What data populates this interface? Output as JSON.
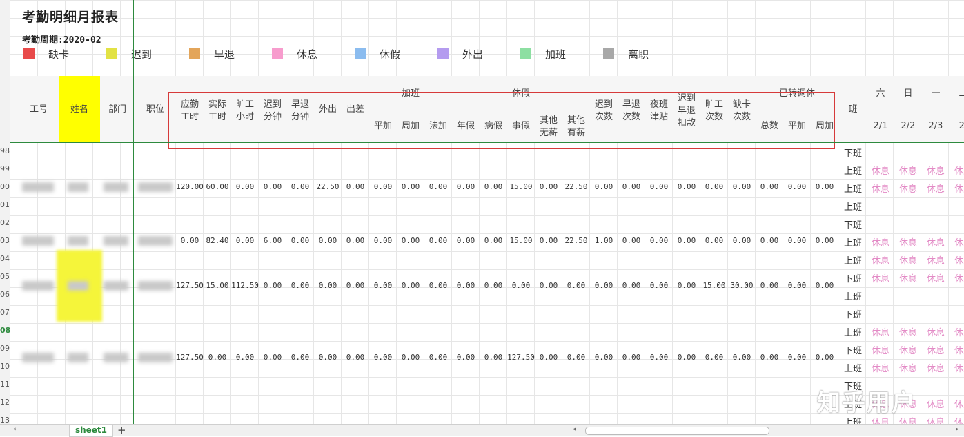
{
  "title": "考勤明细月报表",
  "period": "考勤周期:2020-02",
  "legend": [
    {
      "label": "缺卡",
      "color": "#e84a4a"
    },
    {
      "label": "迟到",
      "color": "#e2e244"
    },
    {
      "label": "早退",
      "color": "#e3a55a"
    },
    {
      "label": "休息",
      "color": "#f79ccd"
    },
    {
      "label": "休假",
      "color": "#8bbcef"
    },
    {
      "label": "外出",
      "color": "#b49bef"
    },
    {
      "label": "加班",
      "color": "#8ddfa2"
    },
    {
      "label": "离职",
      "color": "#a8a8a8"
    }
  ],
  "row_numbers": [
    "98",
    "99",
    "00",
    "01",
    "02",
    "03",
    "04",
    "05",
    "06",
    "07",
    "08",
    "09",
    "10",
    "11",
    "12",
    "13"
  ],
  "headers": {
    "id": "工号",
    "name": "姓名",
    "dept": "部门",
    "position": "职位",
    "due_hours": "应勤\n工时",
    "actual_hours": "实际\n工时",
    "absent_hours": "旷工\n小时",
    "late_minutes": "迟到\n分钟",
    "early_minutes": "早退\n分钟",
    "out": "外出",
    "trip": "出差",
    "overtime_group": "加班",
    "leave_group": "休假",
    "transferred_group": "已转调休",
    "overtime_sub": [
      "平加",
      "周加",
      "法加"
    ],
    "leave_sub": [
      "年假",
      "病假",
      "事假",
      "其他\n无薪",
      "其他\n有薪"
    ],
    "late_count": "迟到\n次数",
    "early_count": "早退\n次数",
    "night_allowance": "夜班\n津贴",
    "late_early_deduct": "迟到\n早退\n扣款",
    "absent_count": "旷工\n次数",
    "missing_card_count": "缺卡\n次数",
    "transferred_sub": [
      "总数",
      "平加",
      "周加"
    ],
    "shift": "班",
    "weekdays": [
      "六",
      "日",
      "一",
      "二"
    ],
    "dates": [
      "2/1",
      "2/2",
      "2/3",
      "2/"
    ]
  },
  "employees": [
    {
      "values": [
        "120.00",
        "60.00",
        "0.00",
        "0.00",
        "0.00",
        "22.50",
        "0.00",
        "0.00",
        "0.00",
        "0.00",
        "0.00",
        "0.00",
        "15.00",
        "0.00",
        "22.50",
        "0.00",
        "0.00",
        "0.00",
        "0.00",
        "0.00",
        "0.00",
        "0.00",
        "0.00",
        "0.00"
      ]
    },
    {
      "values": [
        "0.00",
        "82.40",
        "0.00",
        "6.00",
        "0.00",
        "0.00",
        "0.00",
        "0.00",
        "0.00",
        "0.00",
        "0.00",
        "0.00",
        "15.00",
        "0.00",
        "22.50",
        "1.00",
        "0.00",
        "0.00",
        "0.00",
        "0.00",
        "0.00",
        "0.00",
        "0.00",
        "0.00"
      ]
    },
    {
      "values": [
        "127.50",
        "15.00",
        "112.50",
        "0.00",
        "0.00",
        "0.00",
        "0.00",
        "0.00",
        "0.00",
        "0.00",
        "0.00",
        "0.00",
        "0.00",
        "0.00",
        "0.00",
        "0.00",
        "0.00",
        "0.00",
        "0.00",
        "15.00",
        "30.00",
        "0.00",
        "0.00",
        "0.00"
      ]
    },
    {
      "values": [
        "127.50",
        "0.00",
        "0.00",
        "0.00",
        "0.00",
        "0.00",
        "0.00",
        "0.00",
        "0.00",
        "0.00",
        "0.00",
        "0.00",
        "127.50",
        "0.00",
        "0.00",
        "0.00",
        "0.00",
        "0.00",
        "0.00",
        "0.00",
        "0.00",
        "0.00",
        "0.00",
        "0.00"
      ]
    }
  ],
  "shift_labels": [
    "下班",
    "上班",
    "上班",
    "上班",
    "下班",
    "上班",
    "上班",
    "下班",
    "上班",
    "下班",
    "上班",
    "下班",
    "上班",
    "下班",
    "上班",
    "上班"
  ],
  "rest_label": "休息",
  "sheet_tab": "sheet1",
  "add_tab": "+",
  "watermark": "知乎用户"
}
